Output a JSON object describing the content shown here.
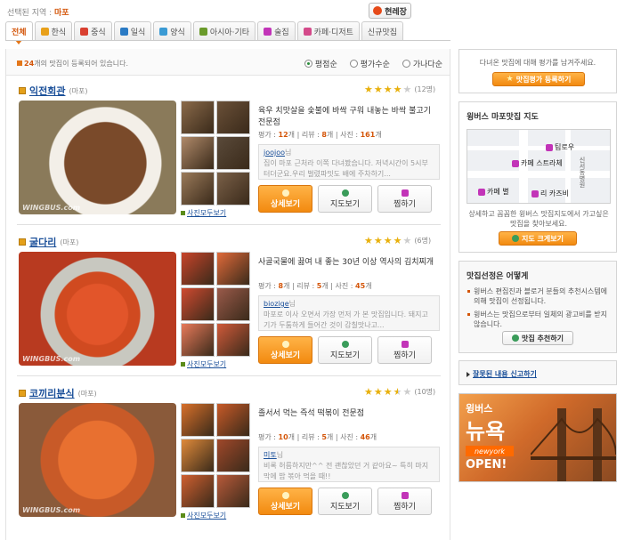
{
  "header": {
    "region_label": "선택된 지역 :",
    "region_value": "마포",
    "now_button": "현레장"
  },
  "tabs": [
    {
      "label": "전체",
      "active": true
    },
    {
      "label": "한식"
    },
    {
      "label": "중식"
    },
    {
      "label": "일식"
    },
    {
      "label": "양식"
    },
    {
      "label": "아시아·기타"
    },
    {
      "label": "술집"
    },
    {
      "label": "카페·디저트"
    },
    {
      "label": "신규맛집"
    }
  ],
  "list": {
    "count_number": "24",
    "count_text": "개의 맛집이 등록되어 있습니다.",
    "sorts": [
      "평점순",
      "평가수순",
      "가나다순"
    ],
    "selected_sort": "평점순"
  },
  "items": [
    {
      "name": "익전회관",
      "area": "(마포)",
      "rating": 4,
      "rating_count": "(12명)",
      "description": "육우 치맛살을 숯불에 바싹 구워 내놓는 바싹 불고기 전문점",
      "views": "12",
      "reviews": "8",
      "photos": "161",
      "review_user": "joojoo",
      "review_text": "집이 마포 근처라 이쪽 다녀봤습니다. 저녁시간이 5시부터더군요.우리 벌렸파밋도 배에 주차하기..."
    },
    {
      "name": "굴다리",
      "area": "(마포)",
      "rating": 4,
      "rating_count": "(6명)",
      "description": "사골국물에 끓여 내 좋는 30년 이상 역사의 김치찌개",
      "views": "8",
      "reviews": "5",
      "photos": "45",
      "review_user": "biozige",
      "review_text": "마포로 이사 오면서 가장 먼저 가 본 맛집입니다. 돼지고기가 두툼하게 들어간 것이 감칠맛나고..."
    },
    {
      "name": "코끼리분식",
      "area": "(마포)",
      "rating": 3.5,
      "rating_count": "(10명)",
      "description": "졸서서 먹는 즉석 떡볶이 전문점",
      "views": "10",
      "reviews": "5",
      "photos": "46",
      "review_user": "미토",
      "review_text": "비록 허름하지만^^ 전 괜찮았던 거 같아요~ 특히 마지막에 밥 볶아 먹을 때!!"
    }
  ],
  "item_labels": {
    "views": "평가 :",
    "reviews": "리뷰 :",
    "photos": "사진 :",
    "unit": "개",
    "sep": "|",
    "nim": "님",
    "detail_button": "상세보기",
    "map_button": "지도보기",
    "save_button": "찜하기",
    "all_photos": "사진모두보기"
  },
  "sidebar": {
    "evaluate_text": "다녀온 맛집에 대해 평가를 남겨주세요.",
    "evaluate_button": "맛집평가 등록하기",
    "map_title": "윙버스 마포맛집 지도",
    "map_labels": [
      "팀로우",
      "카페 스트라체",
      "카페 별",
      "리 카즈비",
      "신서동병원"
    ],
    "map_info": "상세하고 꼼꼼한 윙버스 맛집지도에서 가고싶은 맛집을 찾아보세요.",
    "map_button": "지도 크게보기",
    "select_title": "맛집선정은 어떻게",
    "select_items": [
      "윙버스 편집진과 블로거 분들의 추천시스템에 의해 맛집이 선정됩니다.",
      "윙버스는 맛집으로부터 일체의 광고비를 받지 않습니다."
    ],
    "recommend_button": "맛집 추천하기",
    "report_link": "잘못된 내용 신고하기"
  },
  "ad": {
    "line1": "윙버스",
    "line2": "뉴욕",
    "line3": "newyork",
    "line4": "OPEN!"
  },
  "photos": {
    "watermark": "WINGBUS.com"
  },
  "colors": {
    "accent": "#e4771a",
    "link": "#1a4f99",
    "star": "#e8b00c"
  }
}
